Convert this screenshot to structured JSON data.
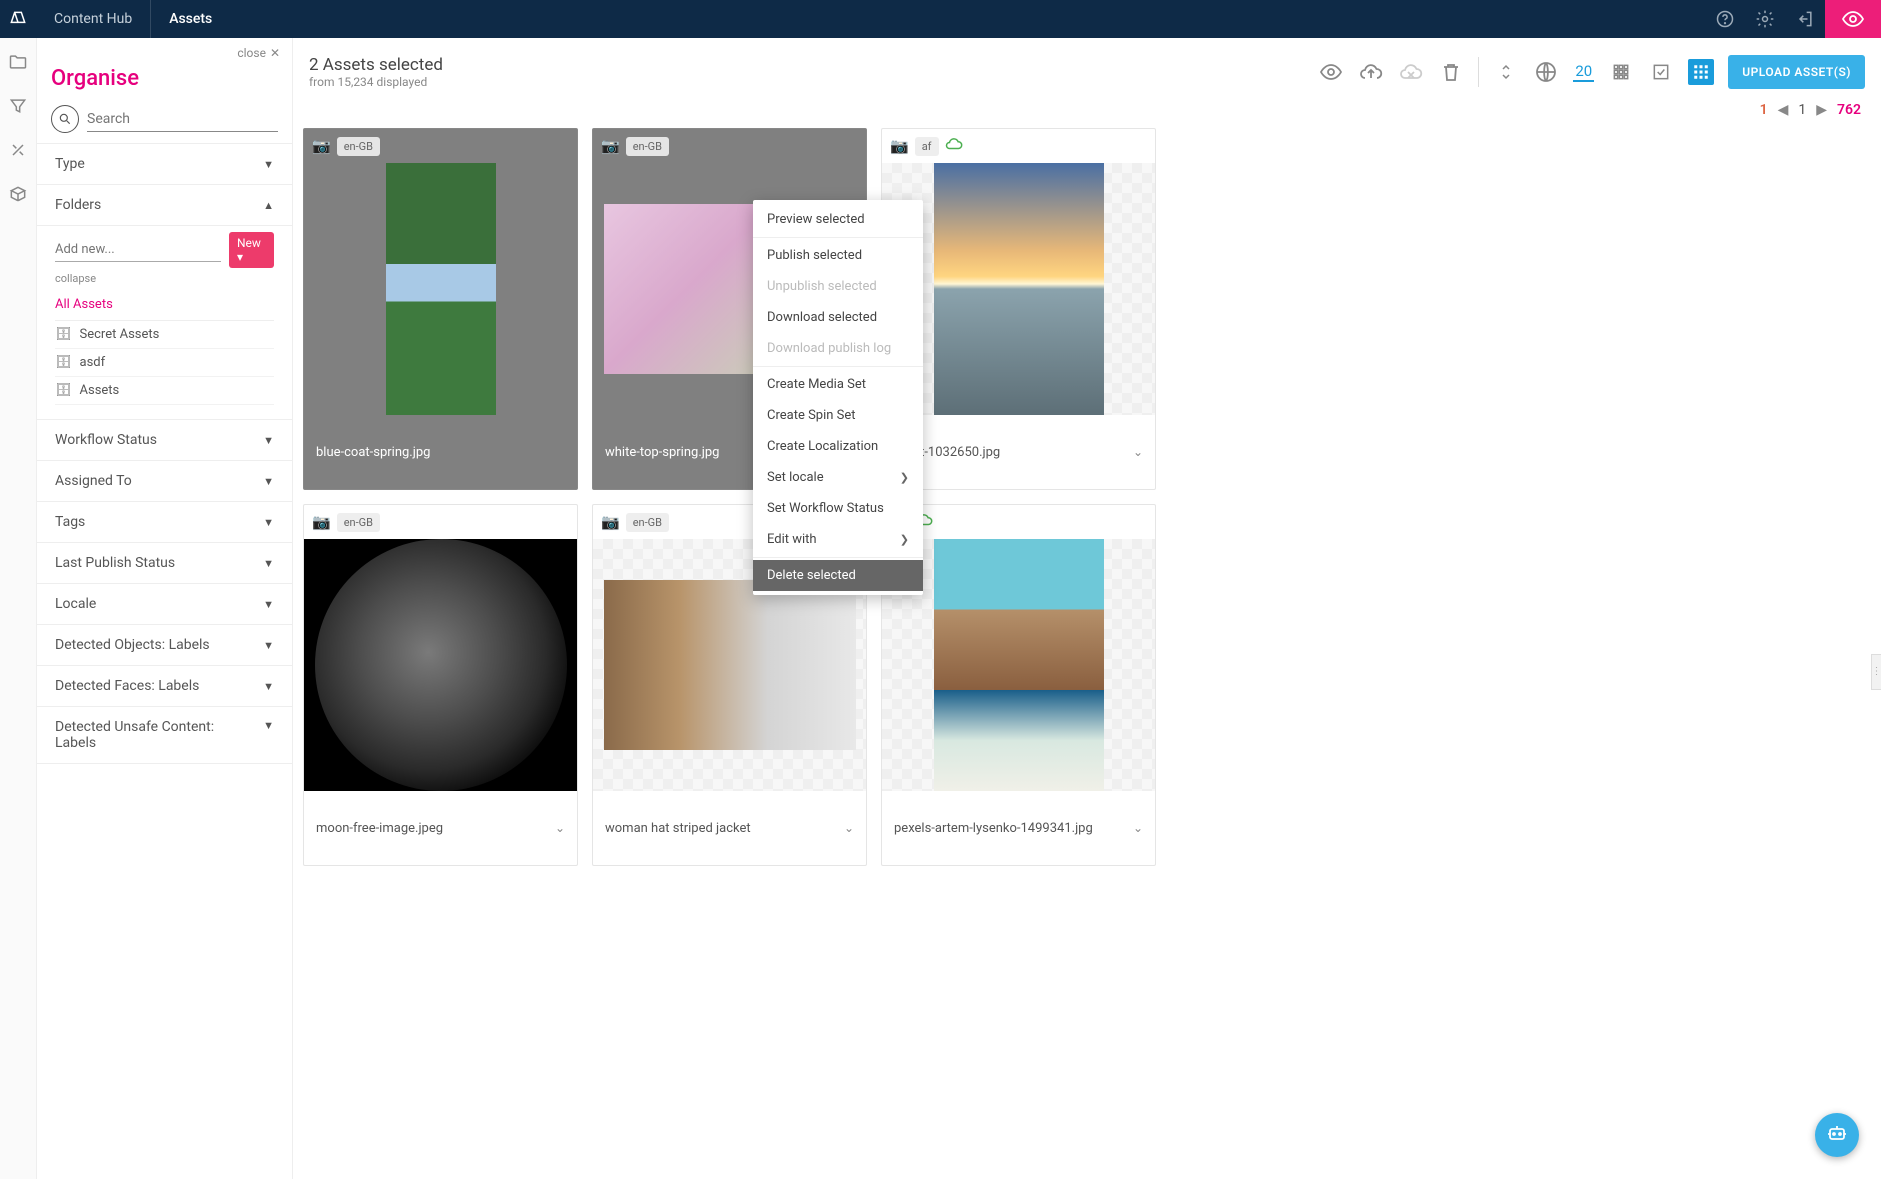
{
  "header": {
    "app_name": "Content Hub",
    "active_tab": "Assets"
  },
  "sidebar": {
    "close_label": "close",
    "title": "Organise",
    "search_placeholder": "Search",
    "sections": {
      "type": "Type",
      "folders": "Folders",
      "workflow_status": "Workflow Status",
      "assigned_to": "Assigned To",
      "tags": "Tags",
      "last_publish_status": "Last Publish Status",
      "locale": "Locale",
      "detected_objects": "Detected Objects: Labels",
      "detected_faces": "Detected Faces: Labels",
      "detected_unsafe": "Detected Unsafe Content: Labels"
    },
    "folders": {
      "add_new_placeholder": "Add new...",
      "new_btn": "New ▾",
      "collapse": "collapse",
      "items": [
        {
          "label": "All Assets",
          "active": true
        },
        {
          "label": "Secret Assets",
          "active": false
        },
        {
          "label": "asdf",
          "active": false
        },
        {
          "label": "Assets",
          "active": false
        }
      ]
    }
  },
  "toolbar": {
    "selection_title": "2 Assets selected",
    "selection_sub": "from 15,234 displayed",
    "page_size": "20",
    "upload_label": "UPLOAD ASSET(S)"
  },
  "pager": {
    "current": "1",
    "page": "1",
    "total": "762"
  },
  "assets": [
    {
      "locale": "en-GB",
      "filename": "blue-coat-spring.jpg",
      "selected": true,
      "published": false
    },
    {
      "locale": "en-GB",
      "filename": "white-top-spring.jpg",
      "selected": true,
      "published": false
    },
    {
      "locale": "af",
      "filename": "upert-1032650.jpg",
      "selected": false,
      "published": true
    },
    {
      "locale": "en-GB",
      "filename": "moon-free-image.jpeg",
      "selected": false,
      "published": false
    },
    {
      "locale": "en-GB",
      "filename": "woman hat striped jacket",
      "selected": false,
      "published": false
    },
    {
      "locale": "",
      "filename": "pexels-artem-lysenko-1499341.jpg",
      "selected": false,
      "published": true
    }
  ],
  "context_menu": {
    "items": [
      {
        "label": "Preview selected",
        "disabled": false
      },
      {
        "label": "Publish selected",
        "disabled": false
      },
      {
        "label": "Unpublish selected",
        "disabled": true
      },
      {
        "label": "Download selected",
        "disabled": false
      },
      {
        "label": "Download publish log",
        "disabled": true
      },
      {
        "label": "Create Media Set",
        "disabled": false
      },
      {
        "label": "Create Spin Set",
        "disabled": false
      },
      {
        "label": "Create Localization",
        "disabled": false
      },
      {
        "label": "Set locale",
        "disabled": false,
        "submenu": true
      },
      {
        "label": "Set Workflow Status",
        "disabled": false
      },
      {
        "label": "Edit with",
        "disabled": false,
        "submenu": true
      },
      {
        "label": "Delete selected",
        "disabled": false,
        "hover": true
      }
    ]
  }
}
